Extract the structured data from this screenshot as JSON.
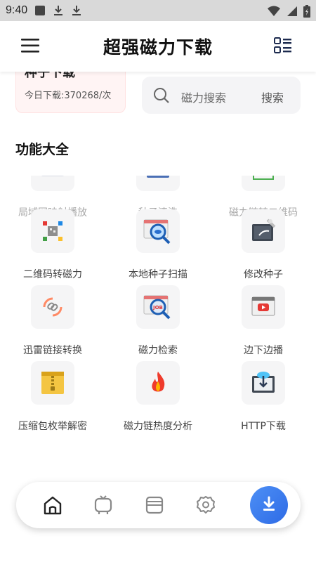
{
  "status": {
    "time": "9:40"
  },
  "header": {
    "title": "超强磁力下载"
  },
  "download_card": {
    "title": "种子下载",
    "count_text": "今日下载:370268/次"
  },
  "search": {
    "placeholder": "磁力搜索",
    "button": "搜索"
  },
  "section": {
    "title": "功能大全"
  },
  "features": [
    {
      "label": "局域网映射播放",
      "icon": "lan-play-icon"
    },
    {
      "label": "种子清洗",
      "icon": "torrent-clean-icon"
    },
    {
      "label": "磁力链转二维码",
      "icon": "magnet-to-qr-icon"
    },
    {
      "label": "二维码转磁力",
      "icon": "qr-to-magnet-icon"
    },
    {
      "label": "本地种子扫描",
      "icon": "local-scan-icon"
    },
    {
      "label": "修改种子",
      "icon": "edit-torrent-icon"
    },
    {
      "label": "迅雷链接转换",
      "icon": "link-convert-icon"
    },
    {
      "label": "磁力检索",
      "icon": "magnet-search-icon"
    },
    {
      "label": "边下边播",
      "icon": "stream-play-icon"
    },
    {
      "label": "压缩包枚举解密",
      "icon": "archive-decrypt-icon"
    },
    {
      "label": "磁力链热度分析",
      "icon": "heat-analysis-icon"
    },
    {
      "label": "HTTP下载",
      "icon": "http-download-icon"
    }
  ],
  "bottom_nav": {
    "items": [
      "home-icon",
      "tv-icon",
      "cards-icon",
      "settings-icon"
    ],
    "fab": "download-icon",
    "accent": "#3476ea"
  }
}
